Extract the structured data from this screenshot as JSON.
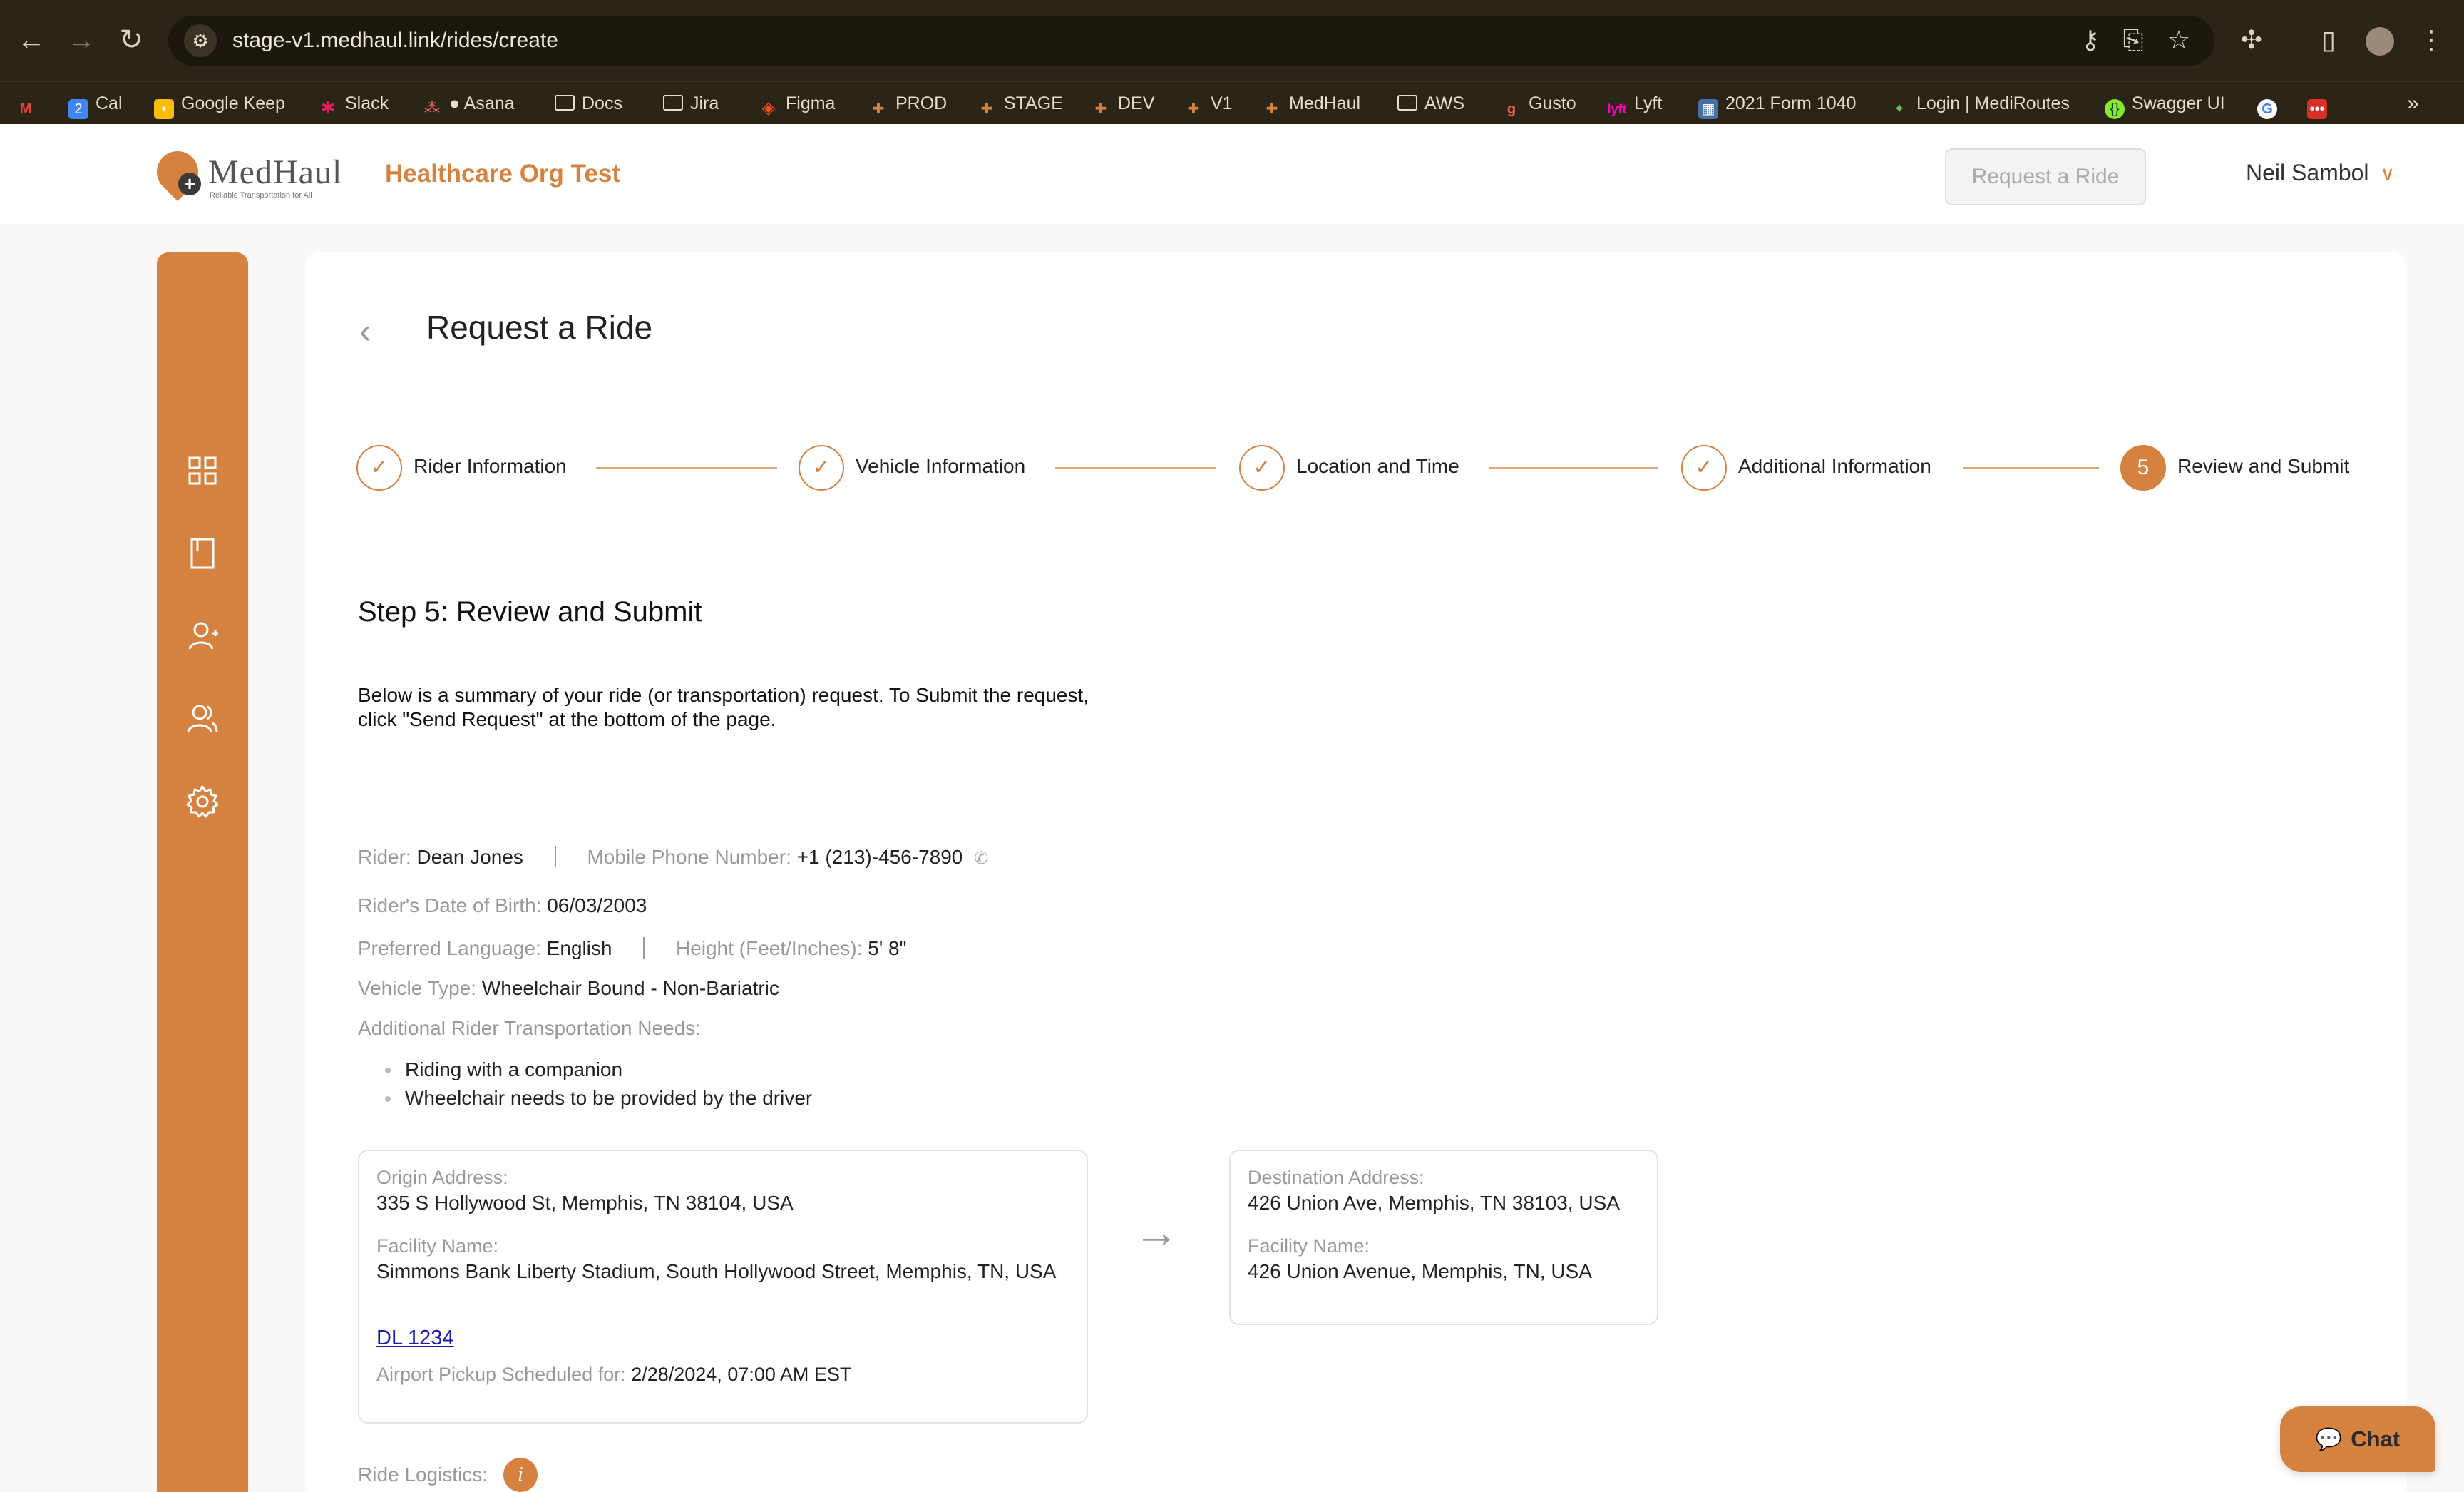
{
  "browser": {
    "url": "stage-v1.medhaul.link/rides/create",
    "bookmarks": [
      {
        "label": "",
        "icon": "gmail-icon",
        "color": "#ea4335"
      },
      {
        "label": "Cal",
        "icon": "calendar-icon",
        "color": "#4285f4"
      },
      {
        "label": "Google Keep",
        "icon": "keep-icon",
        "color": "#fbbc04"
      },
      {
        "label": "Slack",
        "icon": "slack-icon",
        "color": "#7a2a7a"
      },
      {
        "label": "● Asana",
        "icon": "asana-icon",
        "color": "#f06a6a"
      },
      {
        "label": "Docs",
        "icon": "folder-icon",
        "color": "#2b2518"
      },
      {
        "label": "Jira",
        "icon": "folder-icon",
        "color": "#2b2518"
      },
      {
        "label": "Figma",
        "icon": "figma-icon",
        "color": "#a259ff"
      },
      {
        "label": "PROD",
        "icon": "medhaul-icon",
        "color": "#d5813f"
      },
      {
        "label": "STAGE",
        "icon": "medhaul-icon",
        "color": "#d5813f"
      },
      {
        "label": "DEV",
        "icon": "medhaul-icon",
        "color": "#d5813f"
      },
      {
        "label": "V1",
        "icon": "medhaul-icon",
        "color": "#d5813f"
      },
      {
        "label": "MedHaul",
        "icon": "medhaul-icon",
        "color": "#d5813f"
      },
      {
        "label": "AWS",
        "icon": "folder-icon",
        "color": "#2b2518"
      },
      {
        "label": "Gusto",
        "icon": "gusto-icon",
        "color": "#f45d48"
      },
      {
        "label": "Lyft",
        "icon": "lyft-icon",
        "color": "#ff00bf"
      },
      {
        "label": "2021 Form 1040",
        "icon": "irs-icon",
        "color": "#4a6fa5"
      },
      {
        "label": "Login | MediRoutes",
        "icon": "mediroutes-icon",
        "color": "#6dbf4b"
      },
      {
        "label": "Swagger UI",
        "icon": "swagger-icon",
        "color": "#85ea2d"
      },
      {
        "label": "",
        "icon": "google-icon",
        "color": "#ffffff"
      },
      {
        "label": "",
        "icon": "more-icon",
        "color": "#d93025"
      }
    ]
  },
  "header": {
    "logo_text": "MedHaul",
    "logo_tagline": "Reliable Transportation for All",
    "org_name": "Healthcare Org Test",
    "request_ride_label": "Request a Ride",
    "user_name": "Neil Sambol"
  },
  "page": {
    "title": "Request a Ride",
    "steps": [
      {
        "label": "Rider Information",
        "state": "done",
        "marker": "✓"
      },
      {
        "label": "Vehicle Information",
        "state": "done",
        "marker": "✓"
      },
      {
        "label": "Location and Time",
        "state": "done",
        "marker": "✓"
      },
      {
        "label": "Additional Information",
        "state": "done",
        "marker": "✓"
      },
      {
        "label": "Review and Submit",
        "state": "active",
        "marker": "5"
      }
    ],
    "step_heading": "Step 5: Review and Submit",
    "summary": "Below is a summary of your ride (or transportation) request. To Submit the request, click \"Send Request\" at the bottom of the page."
  },
  "review": {
    "rider_label": "Rider:",
    "rider_value": "Dean Jones",
    "phone_label": "Mobile Phone Number:",
    "phone_value": "+1 (213)-456-7890",
    "dob_label": "Rider's Date of Birth:",
    "dob_value": "06/03/2003",
    "language_label": "Preferred Language:",
    "language_value": "English",
    "height_label": "Height (Feet/Inches):",
    "height_value": "5' 8\"",
    "vehicle_label": "Vehicle Type:",
    "vehicle_value": "Wheelchair Bound - Non-Bariatric",
    "needs_label": "Additional Rider Transportation Needs:",
    "needs": [
      "Riding with a companion",
      "Wheelchair needs to be provided by the driver"
    ]
  },
  "origin": {
    "address_label": "Origin Address:",
    "address_value": "335 S Hollywood St, Memphis, TN 38104, USA",
    "facility_label": "Facility Name:",
    "facility_value": "Simmons Bank Liberty Stadium, South Hollywood Street, Memphis, TN, USA",
    "flight_link": "DL 1234",
    "pickup_label": "Airport Pickup Scheduled for:",
    "pickup_value": "2/28/2024, 07:00 AM EST"
  },
  "destination": {
    "address_label": "Destination Address:",
    "address_value": "426 Union Ave, Memphis, TN 38103, USA",
    "facility_label": "Facility Name:",
    "facility_value": "426 Union Avenue, Memphis, TN, USA"
  },
  "logistics": {
    "label": "Ride Logistics:",
    "info_icon": "i"
  },
  "chat": {
    "label": "Chat"
  },
  "colors": {
    "brand": "#d5813f",
    "link": "#1a1aa8"
  }
}
